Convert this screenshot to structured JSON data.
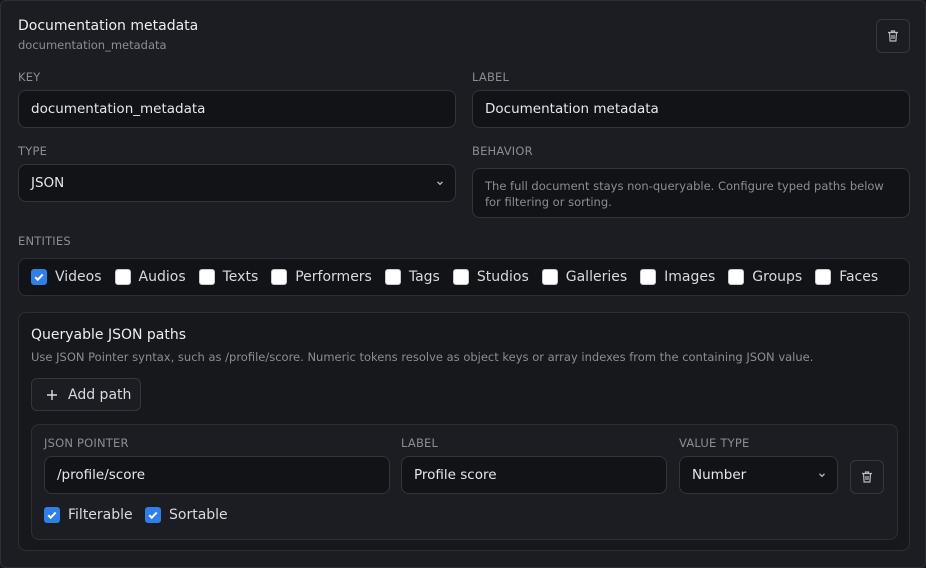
{
  "field": {
    "title": "Documentation metadata",
    "subtitle": "documentation_metadata"
  },
  "key": {
    "label": "KEY",
    "value": "documentation_metadata"
  },
  "label_field": {
    "label": "LABEL",
    "value": "Documentation metadata"
  },
  "type": {
    "label": "TYPE",
    "value": "JSON"
  },
  "behavior": {
    "label": "BEHAVIOR",
    "text": "The full document stays non-queryable. Configure typed paths below for filtering or sorting."
  },
  "entities": {
    "label": "ENTITIES",
    "items": [
      {
        "label": "Videos",
        "checked": true
      },
      {
        "label": "Audios",
        "checked": false
      },
      {
        "label": "Texts",
        "checked": false
      },
      {
        "label": "Performers",
        "checked": false
      },
      {
        "label": "Tags",
        "checked": false
      },
      {
        "label": "Studios",
        "checked": false
      },
      {
        "label": "Galleries",
        "checked": false
      },
      {
        "label": "Images",
        "checked": false
      },
      {
        "label": "Groups",
        "checked": false
      },
      {
        "label": "Faces",
        "checked": false
      }
    ]
  },
  "paths": {
    "title": "Queryable JSON paths",
    "description": "Use JSON Pointer syntax, such as /profile/score. Numeric tokens resolve as object keys or array indexes from the containing JSON value.",
    "add_label": "Add path",
    "row": {
      "pointer_label": "JSON POINTER",
      "pointer_value": "/profile/score",
      "label_label": "LABEL",
      "label_value": "Profile score",
      "type_label": "VALUE TYPE",
      "type_value": "Number",
      "filterable": {
        "label": "Filterable",
        "checked": true
      },
      "sortable": {
        "label": "Sortable",
        "checked": true
      }
    }
  },
  "colors": {
    "accent": "#2f7fe6",
    "background": "#1c1d22"
  },
  "icons": {
    "delete": "trash-icon",
    "add": "plus-icon",
    "dropdown": "chevron-down-icon"
  }
}
